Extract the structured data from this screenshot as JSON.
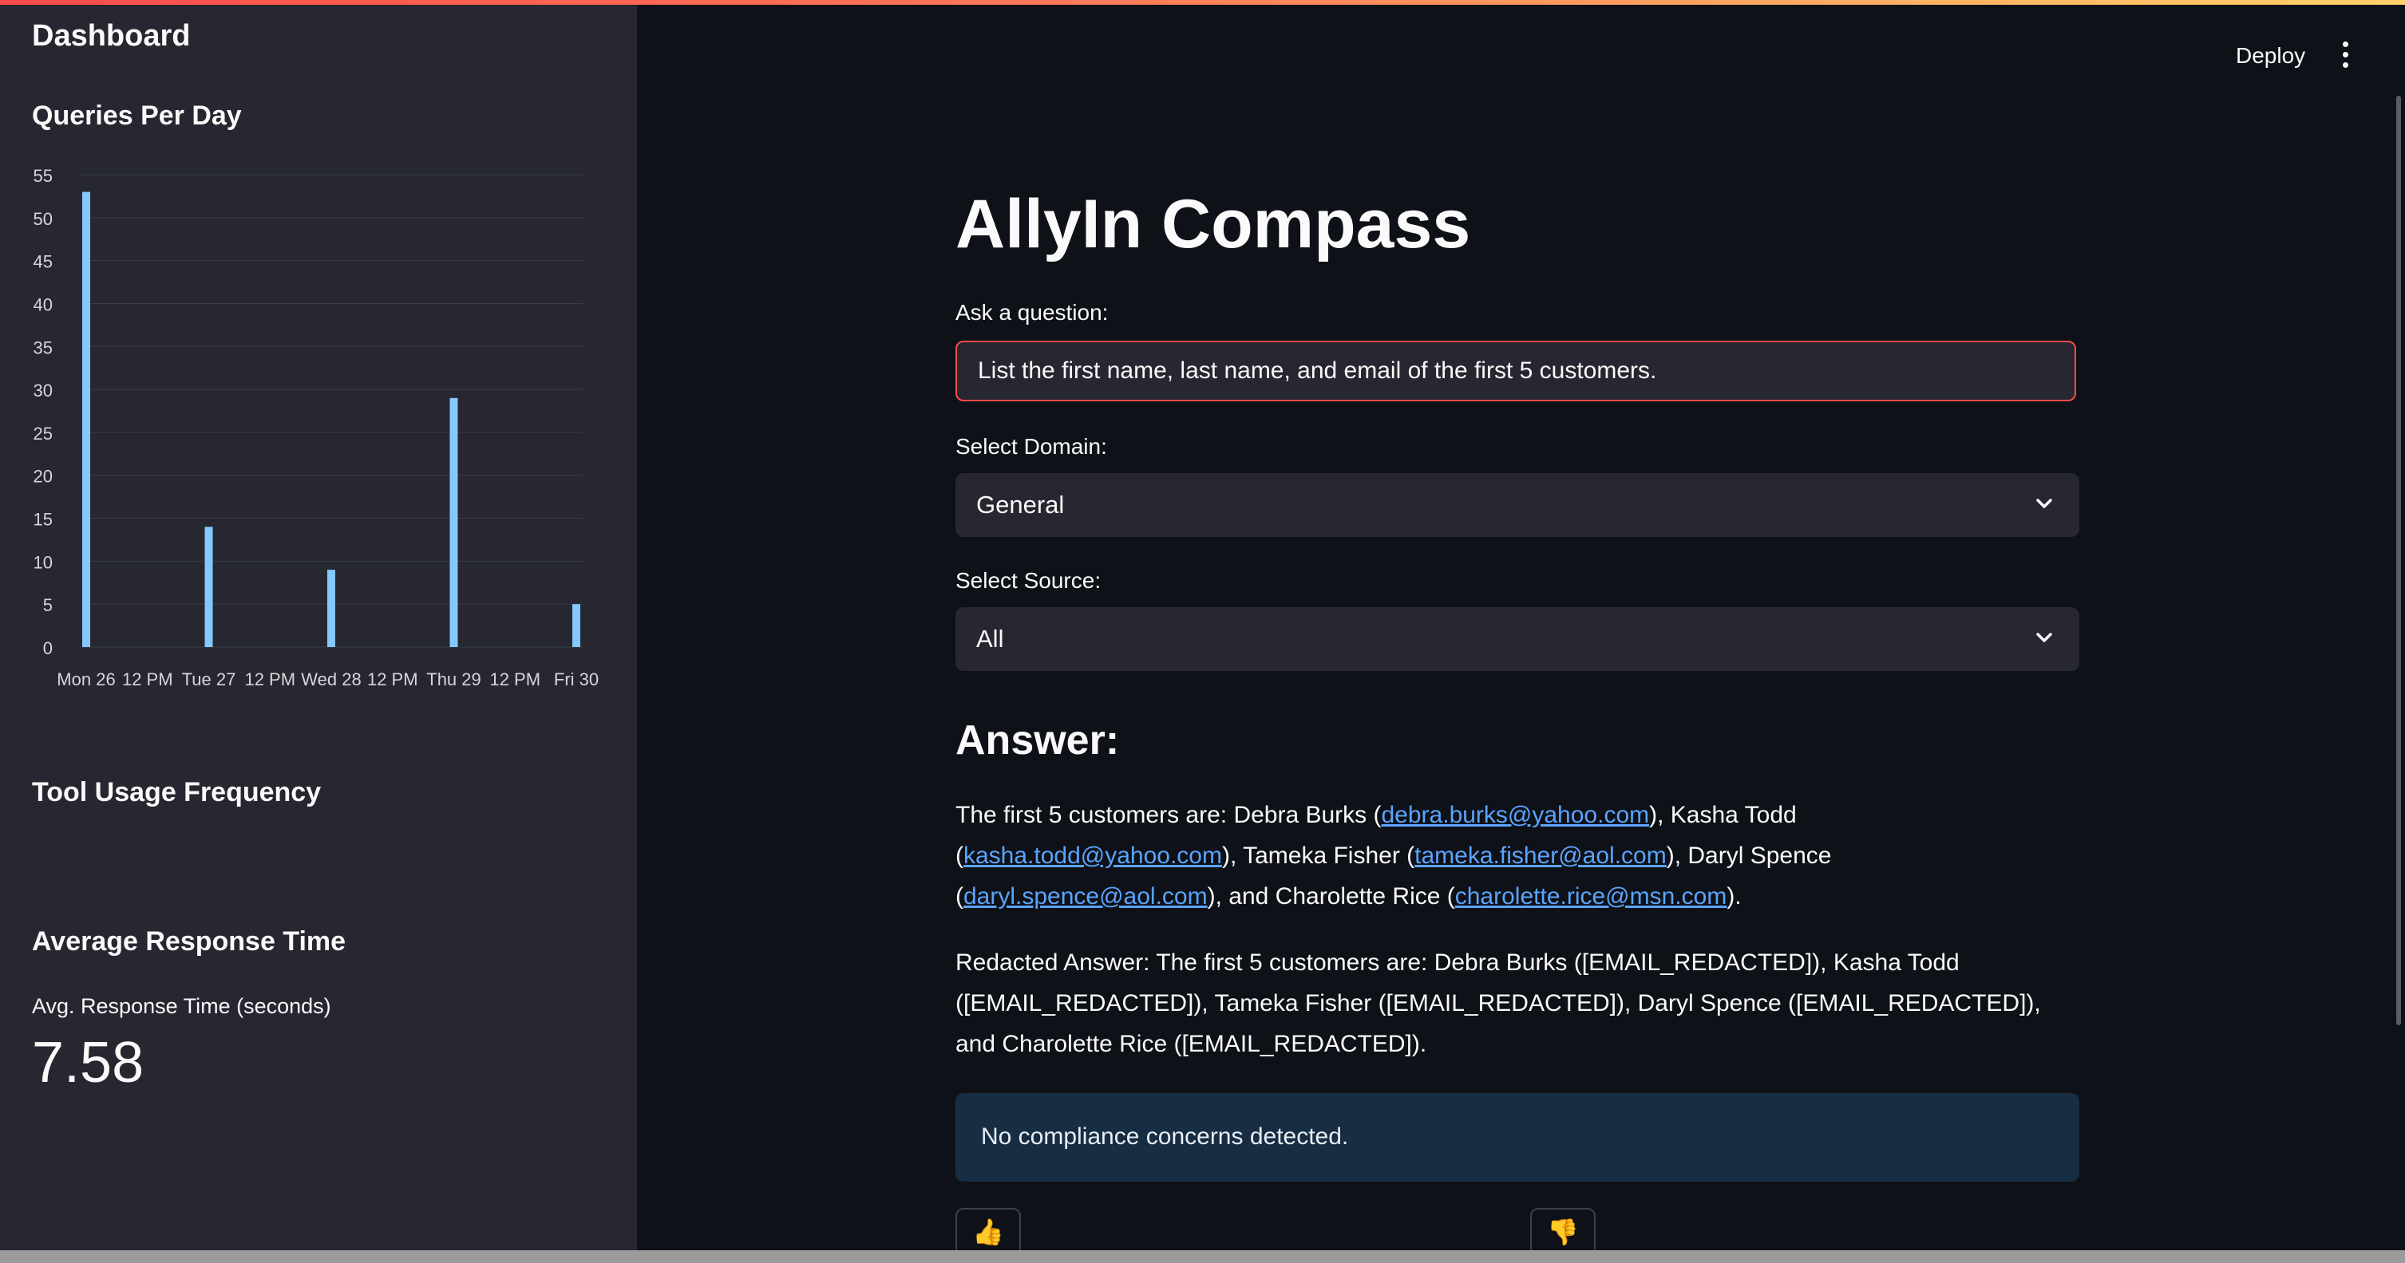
{
  "sidebar": {
    "title": "Dashboard",
    "queries_heading": "Queries Per Day",
    "tool_usage_heading": "Tool Usage Frequency",
    "avg_response_heading": "Average Response Time",
    "avg_response_label": "Avg. Response Time (seconds)",
    "avg_response_value": "7.58"
  },
  "chart_data": {
    "type": "bar",
    "title": "Queries Per Day",
    "xlabel": "",
    "ylabel": "",
    "ylim": [
      0,
      55
    ],
    "yticks": [
      0,
      5,
      10,
      15,
      20,
      25,
      30,
      35,
      40,
      45,
      50,
      55
    ],
    "x_tick_labels": [
      "Mon 26",
      "12 PM",
      "Tue 27",
      "12 PM",
      "Wed 28",
      "12 PM",
      "Thu 29",
      "12 PM",
      "Fri 30"
    ],
    "categories": [
      "Mon 26",
      "Tue 27",
      "Wed 28",
      "Thu 29",
      "Fri 30"
    ],
    "values": [
      53,
      14,
      9,
      29,
      5
    ],
    "bar_color": "#83c9ff",
    "grid": true
  },
  "header": {
    "deploy_label": "Deploy",
    "menu_icon": "kebab-menu-icon"
  },
  "main": {
    "app_title": "AllyIn Compass",
    "question_label": "Ask a question:",
    "question_value": "List the first name, last name, and email of the first 5 customers.",
    "domain_label": "Select Domain:",
    "domain_value": "General",
    "source_label": "Select Source:",
    "source_value": "All",
    "answer_heading": "Answer:",
    "answer": {
      "intro": "The first 5 customers are: Debra Burks (",
      "email1": "debra.burks@yahoo.com",
      "t1": "), Kasha Todd (",
      "email2": "kasha.todd@yahoo.com",
      "t2": "), Tameka Fisher (",
      "email3": "tameka.fisher@aol.com",
      "t3": "), Daryl Spence (",
      "email4": "daryl.spence@aol.com",
      "t4": "), and Charolette Rice (",
      "email5": "charolette.rice@msn.com",
      "t5": ")."
    },
    "redacted_answer": "Redacted Answer: The first 5 customers are: Debra Burks ([EMAIL_REDACTED]), Kasha Todd ([EMAIL_REDACTED]), Tameka Fisher ([EMAIL_REDACTED]), Daryl Spence ([EMAIL_REDACTED]), and Charolette Rice ([EMAIL_REDACTED]).",
    "compliance_message": "No compliance concerns detected.",
    "thumbs_up_icon": "👍",
    "thumbs_down_icon": "👎"
  },
  "colors": {
    "accent": "#ff4b4b",
    "link": "#5aa4ff",
    "info_bg": "#172d43",
    "sidebar_bg": "#262730",
    "main_bg": "#0e1117"
  }
}
